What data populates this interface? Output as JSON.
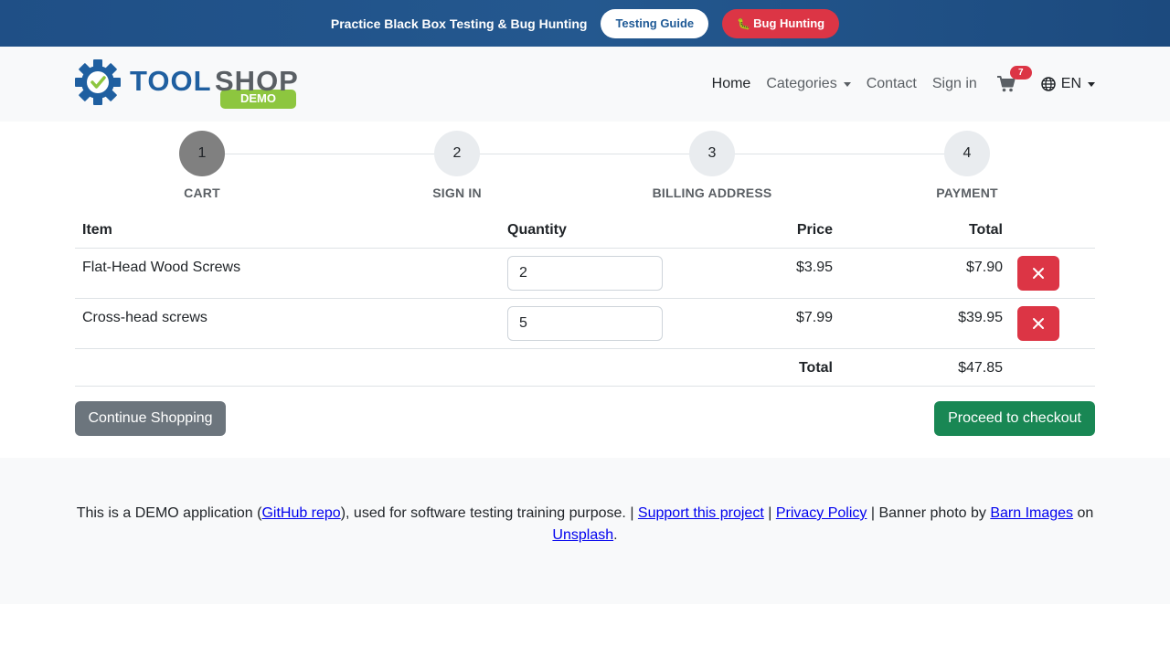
{
  "banner": {
    "text": "Practice Black Box Testing & Bug Hunting",
    "guide_label": "Testing Guide",
    "bug_emoji": "🐛",
    "bug_label": "Bug Hunting"
  },
  "logo": {
    "text_tool": "TOOL",
    "text_shop": "SHOP",
    "badge": "DEMO"
  },
  "nav": {
    "home": "Home",
    "categories": "Categories",
    "contact": "Contact",
    "sign_in": "Sign in",
    "cart_count": "7",
    "language": "EN",
    "cart_icon": "cart-icon",
    "globe_icon": "globe-icon"
  },
  "steps": [
    {
      "number": "1",
      "label": "CART",
      "active": true
    },
    {
      "number": "2",
      "label": "SIGN IN",
      "active": false
    },
    {
      "number": "3",
      "label": "BILLING ADDRESS",
      "active": false
    },
    {
      "number": "4",
      "label": "PAYMENT",
      "active": false
    }
  ],
  "cart": {
    "headers": {
      "item": "Item",
      "quantity": "Quantity",
      "price": "Price",
      "total": "Total"
    },
    "items": [
      {
        "name": "Flat-Head Wood Screws",
        "quantity": "2",
        "price": "$3.95",
        "total": "$7.90"
      },
      {
        "name": "Cross-head screws",
        "quantity": "5",
        "price": "$7.99",
        "total": "$39.95"
      }
    ],
    "total_label": "Total",
    "total_value": "$47.85"
  },
  "actions": {
    "continue_label": "Continue Shopping",
    "checkout_label": "Proceed to checkout"
  },
  "footer": {
    "prefix": "This is a DEMO application (",
    "github": "GitHub repo",
    "middle": "), used for software testing training purpose. | ",
    "support": "Support this project",
    "sep1": " | ",
    "privacy": "Privacy Policy",
    "sep2": " | Banner photo by ",
    "barn": "Barn Images",
    "on": " on ",
    "unsplash": "Unsplash",
    "end": "."
  },
  "colors": {
    "banner": "#1f4f86",
    "danger": "#dc3545",
    "success": "#198754",
    "secondary": "#6c757d",
    "logo_blue": "#1f5fa0",
    "logo_green": "#8dc63f"
  }
}
